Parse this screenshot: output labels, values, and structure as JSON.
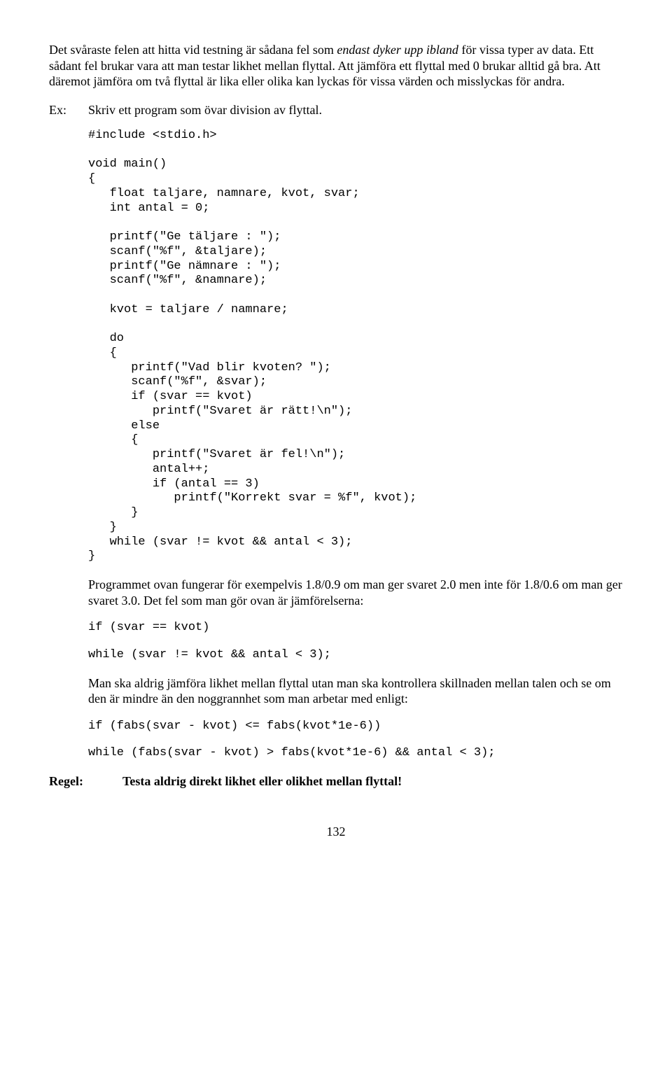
{
  "p1_a": "Det svåraste felen att hitta vid testning är sådana fel som ",
  "p1_i": "endast dyker upp ibland",
  "p1_b": " för vissa typer av data. Ett sådant fel brukar vara att man testar likhet mellan flyttal. Att jämföra ett flyttal med 0 brukar alltid gå bra. Att däremot jämföra om två flyttal är lika eller olika kan lyckas för vissa värden och misslyckas för andra.",
  "ex_label": "Ex:",
  "ex_text": "Skriv ett program som övar division av flyttal.",
  "code1": "#include <stdio.h>\n\nvoid main()\n{\n   float taljare, namnare, kvot, svar;\n   int antal = 0;\n\n   printf(\"Ge täljare : \");\n   scanf(\"%f\", &taljare);\n   printf(\"Ge nämnare : \");\n   scanf(\"%f\", &namnare);\n\n   kvot = taljare / namnare;\n\n   do\n   {\n      printf(\"Vad blir kvoten? \");\n      scanf(\"%f\", &svar);\n      if (svar == kvot)\n         printf(\"Svaret är rätt!\\n\");\n      else\n      {\n         printf(\"Svaret är fel!\\n\");\n         antal++;\n         if (antal == 3)\n            printf(\"Korrekt svar = %f\", kvot);\n      }\n   }\n   while (svar != kvot && antal < 3);\n}",
  "p2": "Programmet ovan fungerar för exempelvis 1.8/0.9 om man ger svaret 2.0 men inte för 1.8/0.6 om man ger svaret 3.0. Det fel som man gör ovan är jämförelserna:",
  "code2": "if (svar == kvot)",
  "code3": "while (svar != kvot && antal < 3);",
  "p3": "Man ska aldrig jämföra likhet mellan flyttal utan man ska kontrollera skillnaden mellan talen och se om den är mindre än den noggrannhet som man arbetar med enligt:",
  "code4": "if (fabs(svar - kvot) <= fabs(kvot*1e-6))",
  "code5": "while (fabs(svar - kvot) > fabs(kvot*1e-6) && antal < 3);",
  "regel_label": "Regel:",
  "regel_text": "Testa aldrig direkt likhet eller olikhet mellan flyttal!",
  "page_num": "132"
}
